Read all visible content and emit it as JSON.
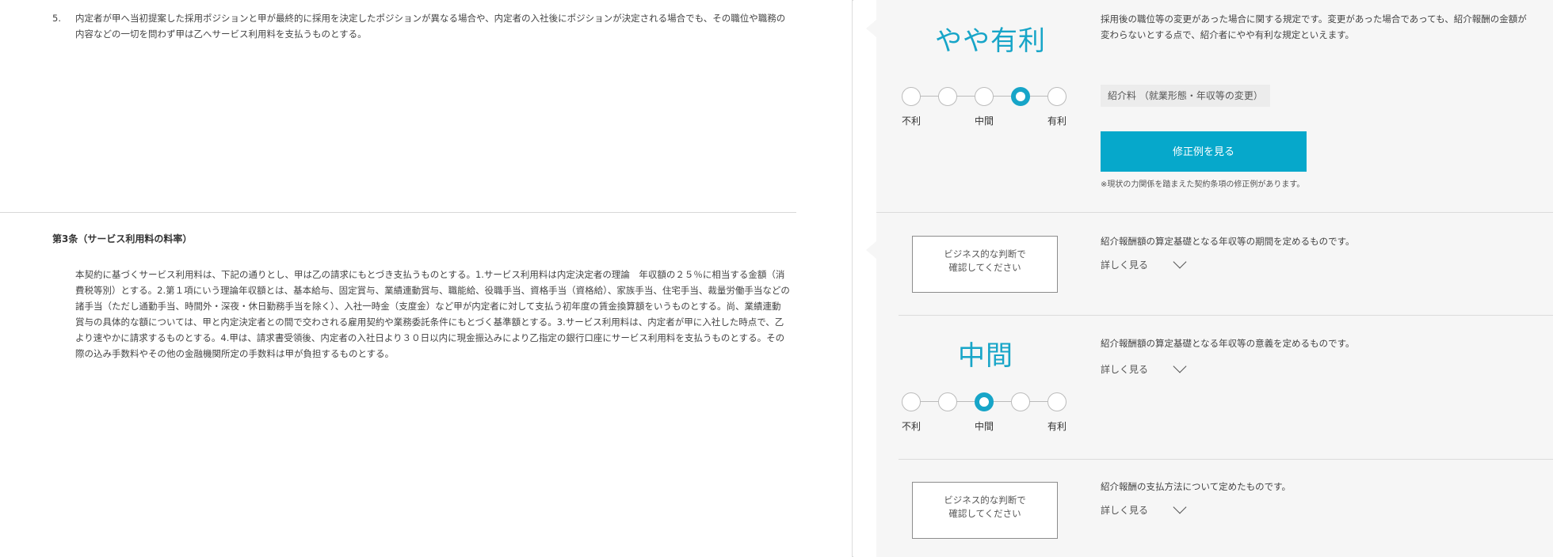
{
  "left": {
    "clause5": {
      "number": "5.",
      "text": "内定者が甲へ当初提案した採用ポジションと甲が最終的に採用を決定したポジションが異なる場合や、内定者の入社後にポジションが決定される場合でも、その職位や職務の内容などの一切を問わず甲は乙へサービス利用料を支払うものとする。"
    },
    "article3": {
      "title": "第3条（サービス利用料の料率）",
      "body": "本契約に基づくサービス利用料は、下記の通りとし、甲は乙の請求にもとづき支払うものとする。1.サービス利用料は内定決定者の理論　年収額の２５％に相当する金額（消費税等別）とする。2.第１項にいう理論年収額とは、基本給与、固定賞与、業績連動賞与、職能給、役職手当、資格手当（資格給）、家族手当、住宅手当、裁量労働手当などの諸手当（ただし通勤手当、時間外・深夜・休日勤務手当を除く）、入社一時金（支度金）など甲が内定者に対して支払う初年度の賃金換算額をいうものとする。尚、業績連動賞与の具体的な額については、甲と内定決定者との間で交わされる雇用契約や業務委託条件にもとづく基準額とする。3.サービス利用料は、内定者が甲に入社した時点で、乙より速やかに請求するものとする。4.甲は、請求書受領後、内定者の入社日より３０日以内に現金振込みにより乙指定の銀行口座にサービス利用料を支払うものとする。その際の込み手数料やその他の金融機関所定の手数料は甲が負担するものとする。"
    }
  },
  "right": {
    "block1": {
      "rating_label": "やや有利",
      "scale_labels": [
        "不利",
        "中間",
        "有利"
      ],
      "selected_index": 3,
      "description": "採用後の職位等の変更があった場合に関する規定です。変更があった場合であっても、紹介報酬の金額が変わらないとする点で、紹介者にやや有利な規定といえます。",
      "tag": "紹介料 （就業形態・年収等の変更）",
      "button_label": "修正例を見る",
      "note": "※現状の力関係を踏まえた契約条項の修正例があります。"
    },
    "block2": {
      "judgement": "ビジネス的な判断で\n確認してください",
      "description": "紹介報酬額の算定基礎となる年収等の期間を定めるものです。",
      "more_label": "詳しく見る"
    },
    "block3": {
      "rating_label": "中間",
      "scale_labels": [
        "不利",
        "中間",
        "有利"
      ],
      "selected_index": 2,
      "description": "紹介報酬額の算定基礎となる年収等の意義を定めるものです。",
      "more_label": "詳しく見る"
    },
    "block4": {
      "judgement": "ビジネス的な判断で\n確認してください",
      "description": "紹介報酬の支払方法について定めたものです。",
      "more_label": "詳しく見る"
    }
  },
  "colors": {
    "accent": "#17a5c8",
    "button": "#06a8cb",
    "panel_bg": "#f6f6f6"
  }
}
